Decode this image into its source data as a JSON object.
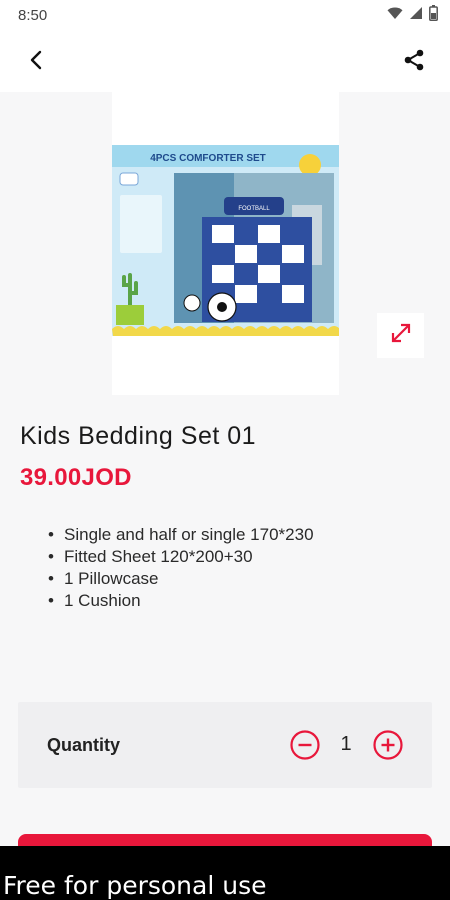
{
  "status_bar": {
    "time": "8:50"
  },
  "product": {
    "title": "Kids Bedding Set 01",
    "price": "39.00JOD",
    "image": {
      "banner_text": "4PCS COMFORTER SET",
      "tag_text": "FOOTBALL"
    },
    "features": [
      "Single and half or single 170*230",
      "Fitted Sheet 120*200+30",
      "1 Pillowcase",
      "1 Cushion"
    ]
  },
  "quantity": {
    "label": "Quantity",
    "value": "1"
  },
  "watermark": "Free for personal use",
  "colors": {
    "accent": "#e8173b",
    "background": "#f7f7f8",
    "qty_box": "#efeff1"
  },
  "icons": [
    "wifi-icon",
    "signal-icon",
    "battery-icon",
    "back-arrow-icon",
    "share-icon",
    "expand-icon",
    "minus-icon",
    "plus-icon"
  ]
}
